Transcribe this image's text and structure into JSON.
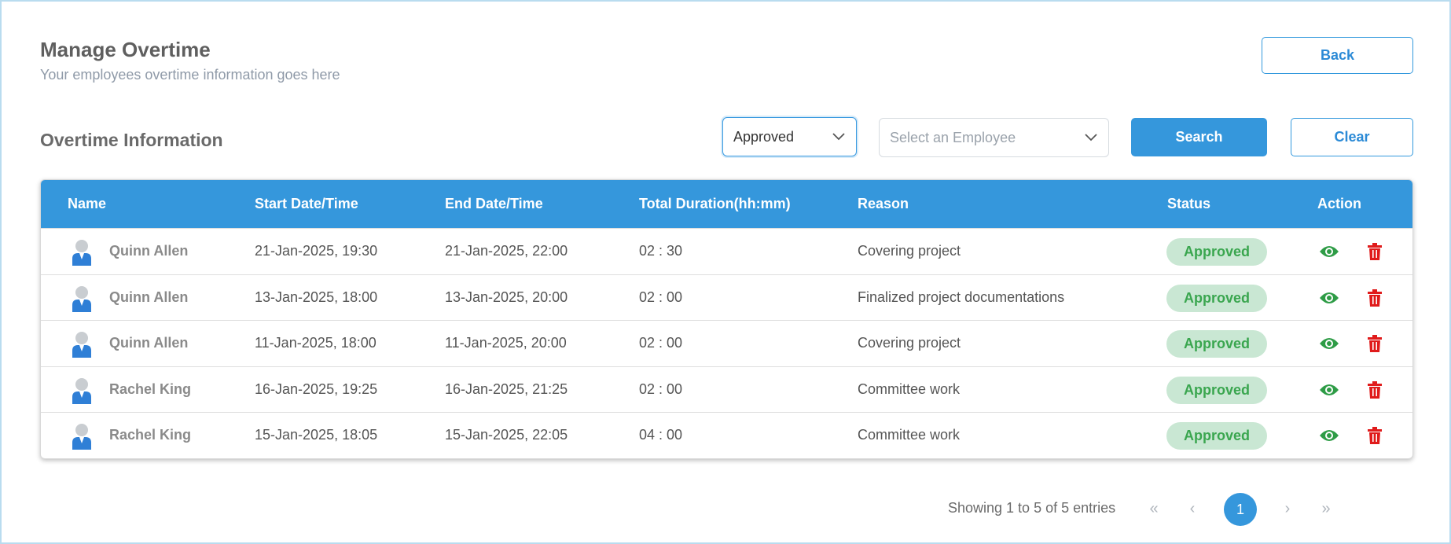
{
  "header": {
    "title": "Manage Overtime",
    "subtitle": "Your employees overtime information goes here",
    "back_label": "Back"
  },
  "filters": {
    "section_title": "Overtime Information",
    "status_value": "Approved",
    "employee_placeholder": "Select an Employee",
    "search_label": "Search",
    "clear_label": "Clear"
  },
  "table": {
    "columns": [
      "Name",
      "Start Date/Time",
      "End Date/Time",
      "Total Duration(hh:mm)",
      "Reason",
      "Status",
      "Action"
    ],
    "rows": [
      {
        "name": "Quinn Allen",
        "start": "21-Jan-2025, 19:30",
        "end": "21-Jan-2025, 22:00",
        "duration": "02 : 30",
        "reason": "Covering project",
        "status": "Approved"
      },
      {
        "name": "Quinn Allen",
        "start": "13-Jan-2025, 18:00",
        "end": "13-Jan-2025, 20:00",
        "duration": "02 : 00",
        "reason": "Finalized project documentations",
        "status": "Approved"
      },
      {
        "name": "Quinn Allen",
        "start": "11-Jan-2025, 18:00",
        "end": "11-Jan-2025, 20:00",
        "duration": "02 : 00",
        "reason": "Covering project",
        "status": "Approved"
      },
      {
        "name": "Rachel King",
        "start": "16-Jan-2025, 19:25",
        "end": "16-Jan-2025, 21:25",
        "duration": "02 : 00",
        "reason": "Committee work",
        "status": "Approved"
      },
      {
        "name": "Rachel King",
        "start": "15-Jan-2025, 18:05",
        "end": "15-Jan-2025, 22:05",
        "duration": "04 : 00",
        "reason": "Committee work",
        "status": "Approved"
      }
    ]
  },
  "pagination": {
    "info": "Showing 1 to 5 of 5 entries",
    "first_icon": "«",
    "prev_icon": "‹",
    "current_page": "1",
    "next_icon": "›",
    "last_icon": "»"
  },
  "icons": {
    "avatar": "user-avatar-icon",
    "view": "eye-icon",
    "delete": "trash-icon",
    "dropdown": "chevron-down-icon"
  },
  "colors": {
    "primary": "#3597dc",
    "status_bg": "#c9e7d3",
    "status_text": "#3aa64f",
    "view_icon": "#2e9c46",
    "delete_icon": "#e01b1b"
  }
}
